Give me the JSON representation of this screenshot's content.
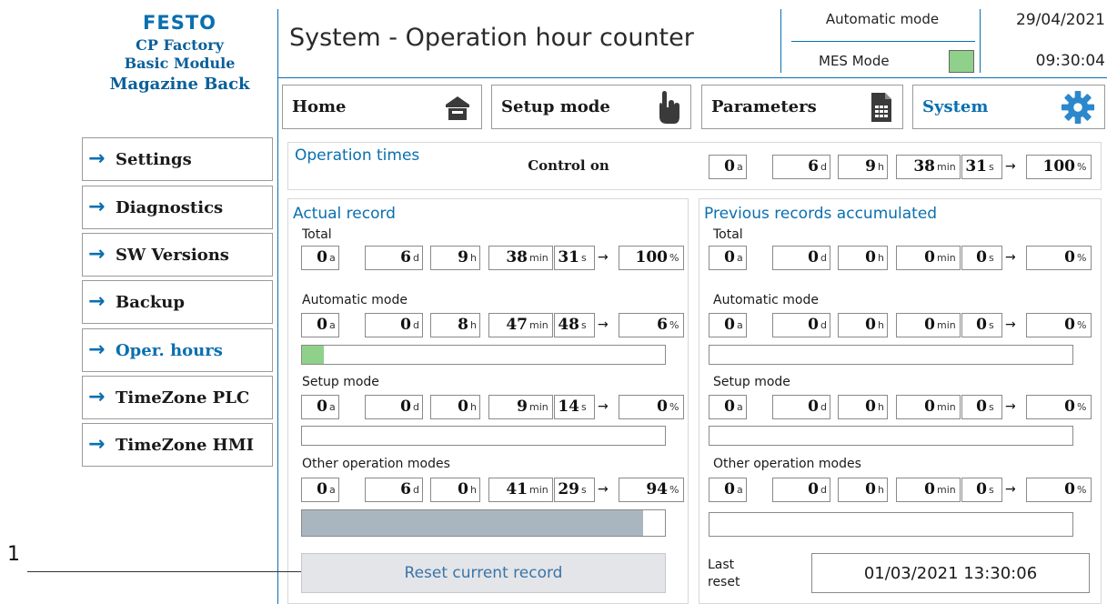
{
  "brand": {
    "name": "FESTO",
    "line1": "CP Factory",
    "line2": "Basic Module",
    "line3": "Magazine Back"
  },
  "sidebar": {
    "items": [
      {
        "label": "Settings"
      },
      {
        "label": "Diagnostics"
      },
      {
        "label": "SW Versions"
      },
      {
        "label": "Backup"
      },
      {
        "label": "Oper. hours",
        "active": true
      },
      {
        "label": "TimeZone PLC"
      },
      {
        "label": "TimeZone HMI"
      }
    ]
  },
  "header": {
    "title": "System - Operation hour counter",
    "automatic_mode": "Automatic mode",
    "mes_mode": "MES Mode",
    "mes_indicator_color": "#8fd18a",
    "date": "29/04/2021",
    "time": "09:30:04"
  },
  "nav": [
    {
      "label": "Home",
      "icon": "home-icon"
    },
    {
      "label": "Setup mode",
      "icon": "hand-pointer-icon"
    },
    {
      "label": "Parameters",
      "icon": "document-table-icon"
    },
    {
      "label": "System",
      "icon": "gear-icon",
      "active": true
    }
  ],
  "units": {
    "a": "a",
    "d": "d",
    "h": "h",
    "min": "min",
    "s": "s",
    "pct": "%"
  },
  "operation_times": {
    "title": "Operation times",
    "status": "Control on",
    "values": {
      "a": "0",
      "d": "6",
      "h": "9",
      "min": "38",
      "s": "31",
      "pct": "100"
    }
  },
  "actual": {
    "title": "Actual record",
    "groups": [
      {
        "label": "Total",
        "values": {
          "a": "0",
          "d": "6",
          "h": "9",
          "min": "38",
          "s": "31",
          "pct": "100"
        }
      },
      {
        "label": "Automatic mode",
        "values": {
          "a": "0",
          "d": "0",
          "h": "8",
          "min": "47",
          "s": "48",
          "pct": "6"
        },
        "bar_fraction": 0.06,
        "bar_color": "#8fd18a"
      },
      {
        "label": "Setup mode",
        "values": {
          "a": "0",
          "d": "0",
          "h": "0",
          "min": "9",
          "s": "14",
          "pct": "0"
        },
        "bar_fraction": 0.0,
        "bar_color": "#8fd18a"
      },
      {
        "label": "Other operation modes",
        "values": {
          "a": "0",
          "d": "6",
          "h": "0",
          "min": "41",
          "s": "29",
          "pct": "94"
        },
        "bar_fraction": 0.94,
        "bar_color": "#aab6bf"
      }
    ],
    "reset_label": "Reset current record"
  },
  "previous": {
    "title": "Previous records accumulated",
    "groups": [
      {
        "label": "Total",
        "values": {
          "a": "0",
          "d": "0",
          "h": "0",
          "min": "0",
          "s": "0",
          "pct": "0"
        }
      },
      {
        "label": "Automatic mode",
        "values": {
          "a": "0",
          "d": "0",
          "h": "0",
          "min": "0",
          "s": "0",
          "pct": "0"
        },
        "bar_fraction": 0.0,
        "bar_color": "#8fd18a"
      },
      {
        "label": "Setup mode",
        "values": {
          "a": "0",
          "d": "0",
          "h": "0",
          "min": "0",
          "s": "0",
          "pct": "0"
        },
        "bar_fraction": 0.0,
        "bar_color": "#8fd18a"
      },
      {
        "label": "Other operation modes",
        "values": {
          "a": "0",
          "d": "0",
          "h": "0",
          "min": "0",
          "s": "0",
          "pct": "0"
        },
        "bar_fraction": 0.0,
        "bar_color": "#aab6bf"
      }
    ],
    "last_reset_label_1": "Last",
    "last_reset_label_2": "reset",
    "last_reset_value": "01/03/2021 13:30:06"
  },
  "callout": "1"
}
